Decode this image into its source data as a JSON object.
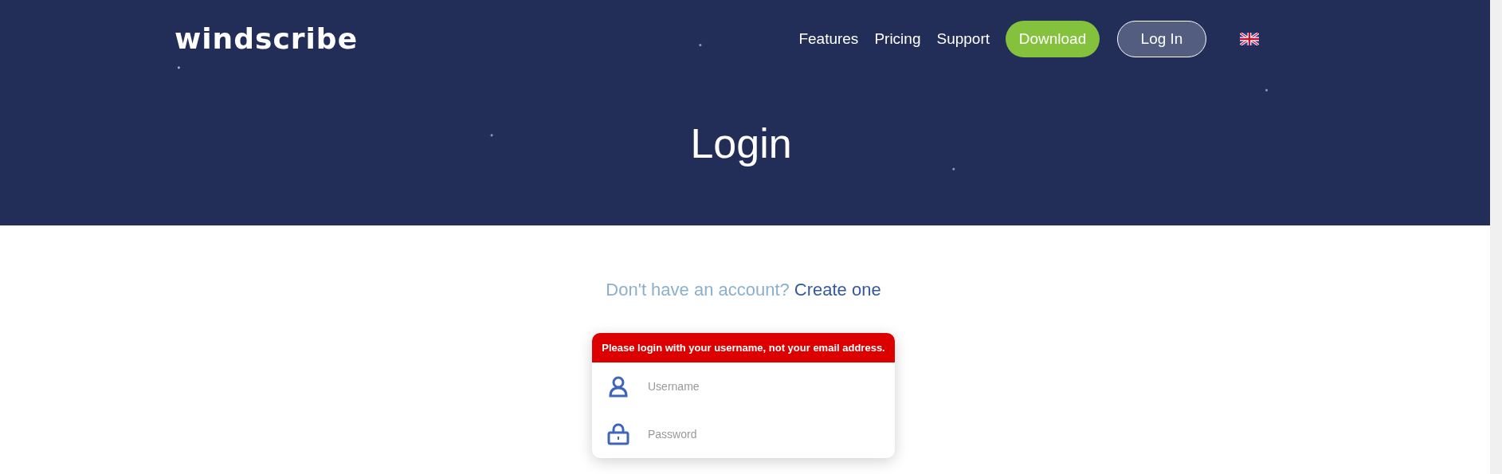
{
  "header": {
    "logo": "windscribe",
    "nav": [
      {
        "label": "Features",
        "kind": "link"
      },
      {
        "label": "Pricing",
        "kind": "link"
      },
      {
        "label": "Support",
        "kind": "link"
      },
      {
        "label": "Download",
        "kind": "primary"
      },
      {
        "label": "Log In",
        "kind": "outline"
      }
    ],
    "title": "Login"
  },
  "signup_prompt": {
    "text": "Don't have an account?",
    "link": "Create one"
  },
  "login_form": {
    "error": "Please login with your username, not your email address.",
    "fields": [
      {
        "kind": "user",
        "placeholder": "Username"
      },
      {
        "kind": "lock",
        "placeholder": "Password"
      }
    ]
  }
}
